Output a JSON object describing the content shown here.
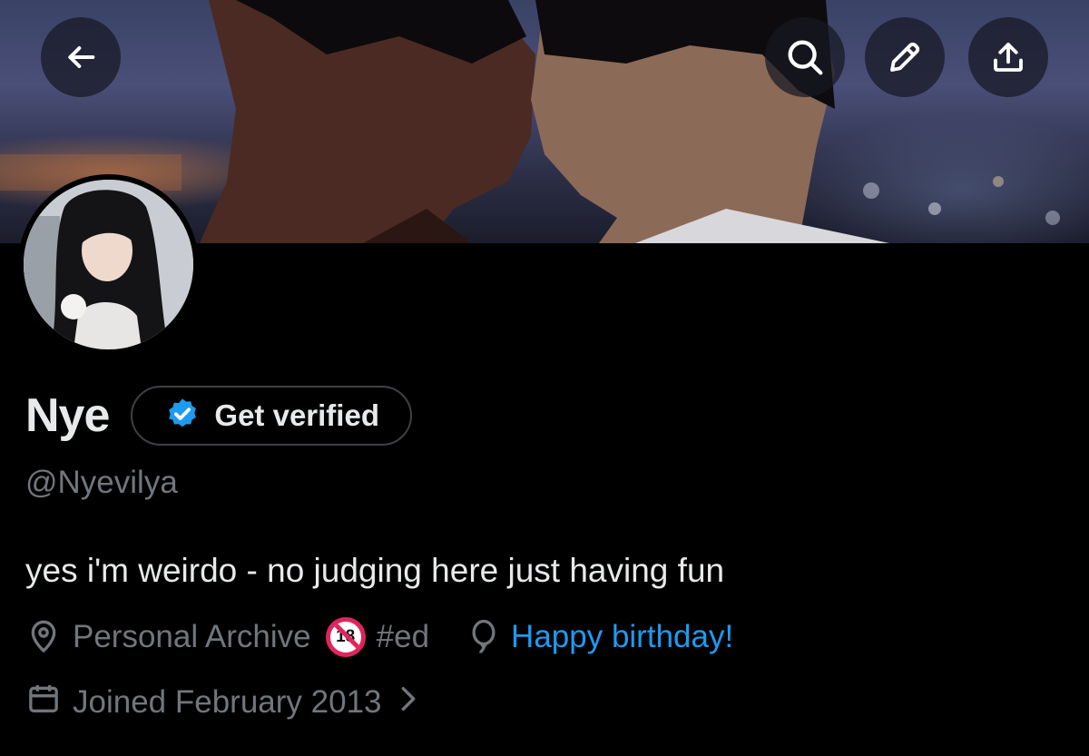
{
  "header": {
    "banner_alt": "Profile banner",
    "back_icon": "arrow-left-icon",
    "search_icon": "search-icon",
    "edit_icon": "pencil-icon",
    "share_icon": "share-upload-icon"
  },
  "profile": {
    "display_name": "Nye",
    "verify_label": "Get verified",
    "handle": "@Nyevilya",
    "bio": "yes i'm weirdo - no judging here just having fun",
    "location": "Personal Archive",
    "age_badge": "18",
    "hashtag": "#ed",
    "birthday": "Happy birthday!",
    "joined": "Joined February 2013"
  },
  "colors": {
    "background": "#000000",
    "primary_text": "#e7e9ea",
    "secondary_text": "#71767b",
    "accent_blue": "#1d9bf0",
    "pill_border": "#3e4144"
  }
}
